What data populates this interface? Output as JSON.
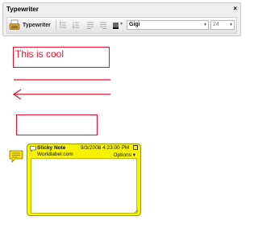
{
  "panel": {
    "title": "Typewriter",
    "close_glyph": "×"
  },
  "toolbar": {
    "typewriter_label": "Typewriter",
    "typewriter_icon": "typewriter-icon",
    "font_value": "Gigi",
    "font_size_value": "24",
    "dropdown_glyph": "▾"
  },
  "canvas": {
    "text_box_text": "This is cool",
    "annotation_color": "#e8112d"
  },
  "sticky_note": {
    "title": "Sticky Note",
    "date": "9/3/2008 4:23:00 PM",
    "author": "Worldlabel.com",
    "options_label": "Options ▾",
    "body_text": "",
    "color": "#f6f200"
  }
}
